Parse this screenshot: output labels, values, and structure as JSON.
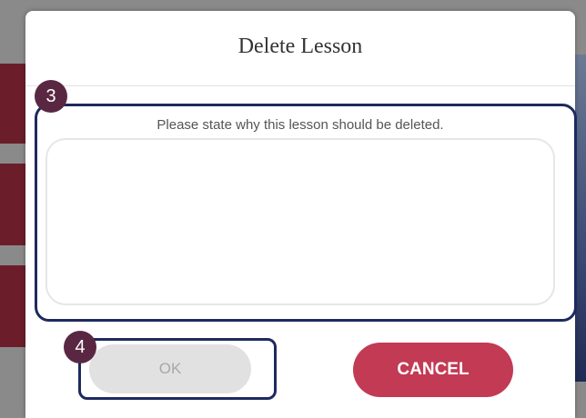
{
  "dialog": {
    "title": "Delete Lesson",
    "prompt": "Please state why this lesson should be deleted.",
    "reason_value": "",
    "ok_label": "OK",
    "cancel_label": "CANCEL"
  },
  "annotations": {
    "reason_step": "3",
    "ok_step": "4"
  },
  "colors": {
    "accent": "#c23a54",
    "badge": "#5a2742",
    "callout_border": "#1e2a5e",
    "disabled_button": "#e1e1e1"
  }
}
